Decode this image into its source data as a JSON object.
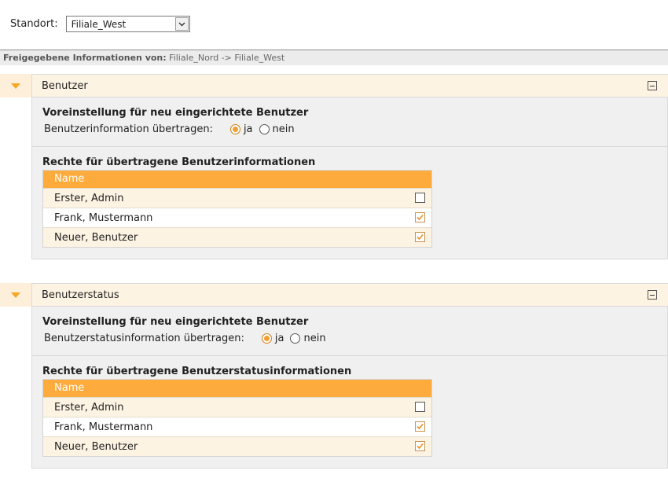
{
  "standort": {
    "label": "Standort:",
    "selected": "Filiale_West"
  },
  "info_bar": {
    "prefix": "Freigegebene Informationen von:",
    "route": "Filiale_Nord -> Filiale_West"
  },
  "sections": [
    {
      "title": "Benutzer",
      "defaults_title": "Voreinstellung für neu eingerichtete Benutzer",
      "question": "Benutzerinformation übertragen:",
      "opt_yes": "ja",
      "opt_no": "nein",
      "selected": "ja",
      "rights_title": "Rechte für übertragene Benutzerinformationen",
      "column": "Name",
      "rows": [
        {
          "name": "Erster, Admin",
          "checked": false
        },
        {
          "name": "Frank, Mustermann",
          "checked": true
        },
        {
          "name": "Neuer, Benutzer",
          "checked": true
        }
      ]
    },
    {
      "title": "Benutzerstatus",
      "defaults_title": "Voreinstellung für neu eingerichtete Benutzer",
      "question": "Benutzerstatusinformation übertragen:",
      "opt_yes": "ja",
      "opt_no": "nein",
      "selected": "ja",
      "rights_title": "Rechte für übertragene Benutzerstatusinformationen",
      "column": "Name",
      "rows": [
        {
          "name": "Erster, Admin",
          "checked": false
        },
        {
          "name": "Frank, Mustermann",
          "checked": true
        },
        {
          "name": "Neuer, Benutzer",
          "checked": true
        }
      ]
    }
  ],
  "colors": {
    "accent": "#fdab3c",
    "checkmark": "#e8902a",
    "toggle_arrow": "#f5a623"
  },
  "icons": {
    "expand": "triangle-down-icon",
    "collapse": "minus-box-icon",
    "dropdown": "chevron-down-icon"
  }
}
